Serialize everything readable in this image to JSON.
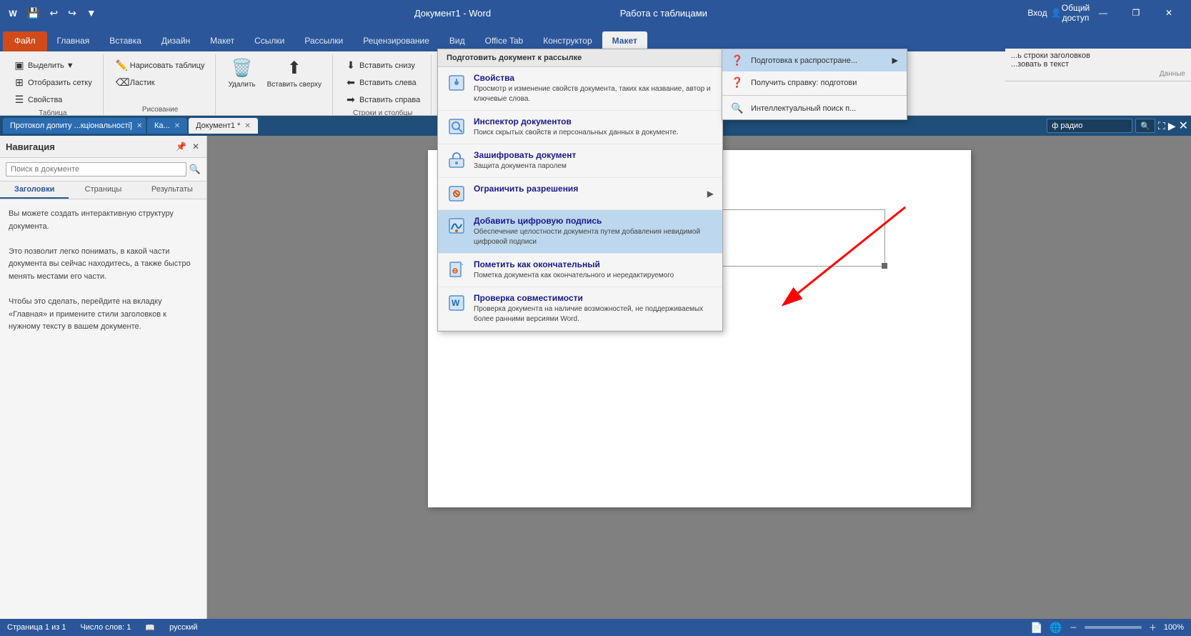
{
  "titleBar": {
    "title": "Документ1 - Word",
    "contextTitle": "Работа с таблицами",
    "saveIcon": "💾",
    "undoIcon": "↩",
    "redoIcon": "↪",
    "customizeIcon": "▼",
    "minimizeIcon": "—",
    "restoreIcon": "❐",
    "closeIcon": "✕"
  },
  "ribbonTabs": [
    {
      "label": "Файл",
      "id": "file",
      "active": false
    },
    {
      "label": "Главная",
      "id": "home",
      "active": false
    },
    {
      "label": "Вставка",
      "id": "insert",
      "active": false
    },
    {
      "label": "Дизайн",
      "id": "design",
      "active": false
    },
    {
      "label": "Макет",
      "id": "layout",
      "active": false
    },
    {
      "label": "Ссылки",
      "id": "references",
      "active": false
    },
    {
      "label": "Рассылки",
      "id": "mailings",
      "active": false
    },
    {
      "label": "Рецензирование",
      "id": "review",
      "active": false
    },
    {
      "label": "Вид",
      "id": "view",
      "active": false
    },
    {
      "label": "Office Tab",
      "id": "officetab",
      "active": false
    },
    {
      "label": "Конструктор",
      "id": "constructor",
      "active": false
    },
    {
      "label": "Макет",
      "id": "layout2",
      "active": true
    }
  ],
  "ribbonGroups": {
    "tableGroup": {
      "label": "Таблица",
      "buttons": [
        {
          "label": "Выделить ▼",
          "icon": "▣"
        },
        {
          "label": "Отобразить сетку",
          "icon": "⊞"
        },
        {
          "label": "Свойства",
          "icon": "☰"
        }
      ]
    },
    "drawGroup": {
      "label": "Рисование",
      "buttons": [
        {
          "label": "Нарисовать таблицу",
          "icon": "✏️"
        },
        {
          "label": "Ластик",
          "icon": "⌫"
        }
      ]
    },
    "deleteGroup": {
      "label": "",
      "buttons": [
        {
          "label": "Удалить",
          "icon": "🗑️"
        },
        {
          "label": "Вставить\nсверху",
          "icon": "⬆"
        }
      ]
    },
    "rowColGroup": {
      "label": "Строки и столбцы",
      "buttons": [
        {
          "label": "Вставить снизу",
          "icon": "⬇"
        },
        {
          "label": "Вставить слева",
          "icon": "⬅"
        },
        {
          "label": "Вставить справа",
          "icon": "➡"
        }
      ]
    }
  },
  "toolbar": {
    "signin": "Вход",
    "share": "Общий доступ"
  },
  "tabBar": {
    "tabs": [
      {
        "label": "Протокол допиту ...кциональності]",
        "active": false
      },
      {
        "label": "Ка...",
        "active": false
      }
    ],
    "activeDoc": "Документ1 *",
    "searchPlaceholder": "ф радио"
  },
  "navPane": {
    "title": "Навигация",
    "searchPlaceholder": "Поиск в документе",
    "tabs": [
      "Заголовки",
      "Страницы",
      "Результаты"
    ],
    "activeTab": "Заголовки",
    "content": [
      "Вы можете создать интерактивную структуру документа.",
      "",
      "Это позволит легко понимать, в какой части документа вы сейчас находитесь, а также быстро менять местами его части.",
      "",
      "Чтобы это сделать, перейдите на вкладку «Главная» и примените стили заголовков к нужному тексту в вашем документе."
    ]
  },
  "prepareMenu": {
    "header": "Подготовить документ к рассылке",
    "items": [
      {
        "id": "properties",
        "title": "Свойства",
        "desc": "Просмотр и изменение свойств документа, таких как название, автор и ключевые слова.",
        "icon": "ℹ️"
      },
      {
        "id": "inspector",
        "title": "Инспектор документов",
        "desc": "Поиск скрытых свойств и персональных данных в документе.",
        "icon": "🔍"
      },
      {
        "id": "encrypt",
        "title": "Зашифровать документ",
        "desc": "Защита документа паролем",
        "icon": "🔒"
      },
      {
        "id": "restrict",
        "title": "Ограничить разрешения",
        "desc": "",
        "icon": "🚫",
        "hasArrow": true
      },
      {
        "id": "signature",
        "title": "Добавить цифровую подпись",
        "desc": "Обеспечение целостности документа путем добавления невидимой цифровой подписи",
        "icon": "✍️",
        "highlighted": true
      },
      {
        "id": "final",
        "title": "Пометить как окончательный",
        "desc": "Пометка документа как окончательного и нередактируемого",
        "icon": "📄"
      },
      {
        "id": "compat",
        "title": "Проверка совместимости",
        "desc": "Проверка документа на наличие возможностей, не поддерживаемых более ранними версиями Word.",
        "icon": "📋"
      }
    ]
  },
  "submenu": {
    "items": [
      {
        "label": "Подготовка к распростране...",
        "active": true,
        "hasArrow": true
      },
      {
        "label": "Получить справку: подготови",
        "active": false
      },
      {
        "label": "Интеллектуальный поиск п...",
        "active": false
      }
    ]
  },
  "statusBar": {
    "page": "Страница 1 из 1",
    "words": "Число слов: 1",
    "language": "русский",
    "zoom": "100%"
  }
}
